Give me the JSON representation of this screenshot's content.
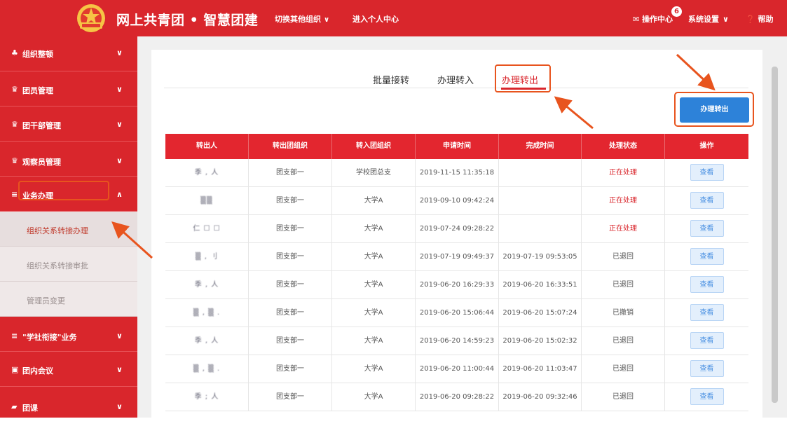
{
  "header": {
    "app_title": "网上共青团 • 智慧团建",
    "switch_org": "切换其他组织",
    "personal_center": "进入个人中心",
    "operation_center": "操作中心",
    "notification_count": "6",
    "system_settings": "系统设置",
    "help": "帮助"
  },
  "sidebar": {
    "items": [
      {
        "label": "组织整顿",
        "icon": "org-tree-icon",
        "state": "collapsed"
      },
      {
        "label": "团员管理",
        "icon": "members-icon",
        "state": "collapsed"
      },
      {
        "label": "团干部管理",
        "icon": "cadres-icon",
        "state": "collapsed"
      },
      {
        "label": "观察员管理",
        "icon": "observers-icon",
        "state": "collapsed"
      },
      {
        "label": "业务办理",
        "icon": "list-icon",
        "state": "expanded"
      }
    ],
    "sub_items": [
      {
        "label": "组织关系转接办理",
        "active": true
      },
      {
        "label": "组织关系转接审批",
        "active": false
      },
      {
        "label": "管理员变更",
        "active": false
      }
    ],
    "items_after": [
      {
        "label": "\"学社衔接\"业务",
        "icon": "list-icon"
      },
      {
        "label": "团内会议",
        "icon": "meeting-icon"
      },
      {
        "label": "团课",
        "icon": "lesson-icon"
      }
    ]
  },
  "tabs": [
    {
      "label": "批量接转",
      "active": false
    },
    {
      "label": "办理转入",
      "active": false
    },
    {
      "label": "办理转出",
      "active": true
    }
  ],
  "action_button": "办理转出",
  "table": {
    "headers": [
      "转出人",
      "转出团组织",
      "转入团组织",
      "申请时间",
      "完成时间",
      "处理状态",
      "操作"
    ],
    "rows": [
      {
        "name": "季 , 人",
        "from": "团支部一",
        "to": "学校团总支",
        "applied": "2019-11-15 11:35:18",
        "completed": "",
        "status": "正在处理",
        "action": "查看"
      },
      {
        "name": "▒▒",
        "from": "团支部一",
        "to": "大学A",
        "applied": "2019-09-10 09:42:24",
        "completed": "",
        "status": "正在处理",
        "action": "查看"
      },
      {
        "name": "仁 ☐ ☐",
        "from": "团支部一",
        "to": "大学A",
        "applied": "2019-07-24 09:28:22",
        "completed": "",
        "status": "正在处理",
        "action": "查看"
      },
      {
        "name": "▒ , 刂",
        "from": "团支部一",
        "to": "大学A",
        "applied": "2019-07-19 09:49:37",
        "completed": "2019-07-19 09:53:05",
        "status": "已退回",
        "action": "查看"
      },
      {
        "name": "季 , 人",
        "from": "团支部一",
        "to": "大学A",
        "applied": "2019-06-20 16:29:33",
        "completed": "2019-06-20 16:33:51",
        "status": "已退回",
        "action": "查看"
      },
      {
        "name": "▒ , ▒ .",
        "from": "团支部一",
        "to": "大学A",
        "applied": "2019-06-20 15:06:44",
        "completed": "2019-06-20 15:07:24",
        "status": "已撤销",
        "action": "查看"
      },
      {
        "name": "季 , 人",
        "from": "团支部一",
        "to": "大学A",
        "applied": "2019-06-20 14:59:23",
        "completed": "2019-06-20 15:02:32",
        "status": "已退回",
        "action": "查看"
      },
      {
        "name": "▒ , ▒ .",
        "from": "团支部一",
        "to": "大学A",
        "applied": "2019-06-20 11:00:44",
        "completed": "2019-06-20 11:03:47",
        "status": "已退回",
        "action": "查看"
      },
      {
        "name": "季 ; 人",
        "from": "团支部一",
        "to": "大学A",
        "applied": "2019-06-20 09:28:22",
        "completed": "2019-06-20 09:32:46",
        "status": "已退回",
        "action": "查看"
      }
    ]
  },
  "colors": {
    "brand_red": "#d9262c",
    "annotation_orange": "#e8541e",
    "primary_blue": "#2d82d9"
  }
}
